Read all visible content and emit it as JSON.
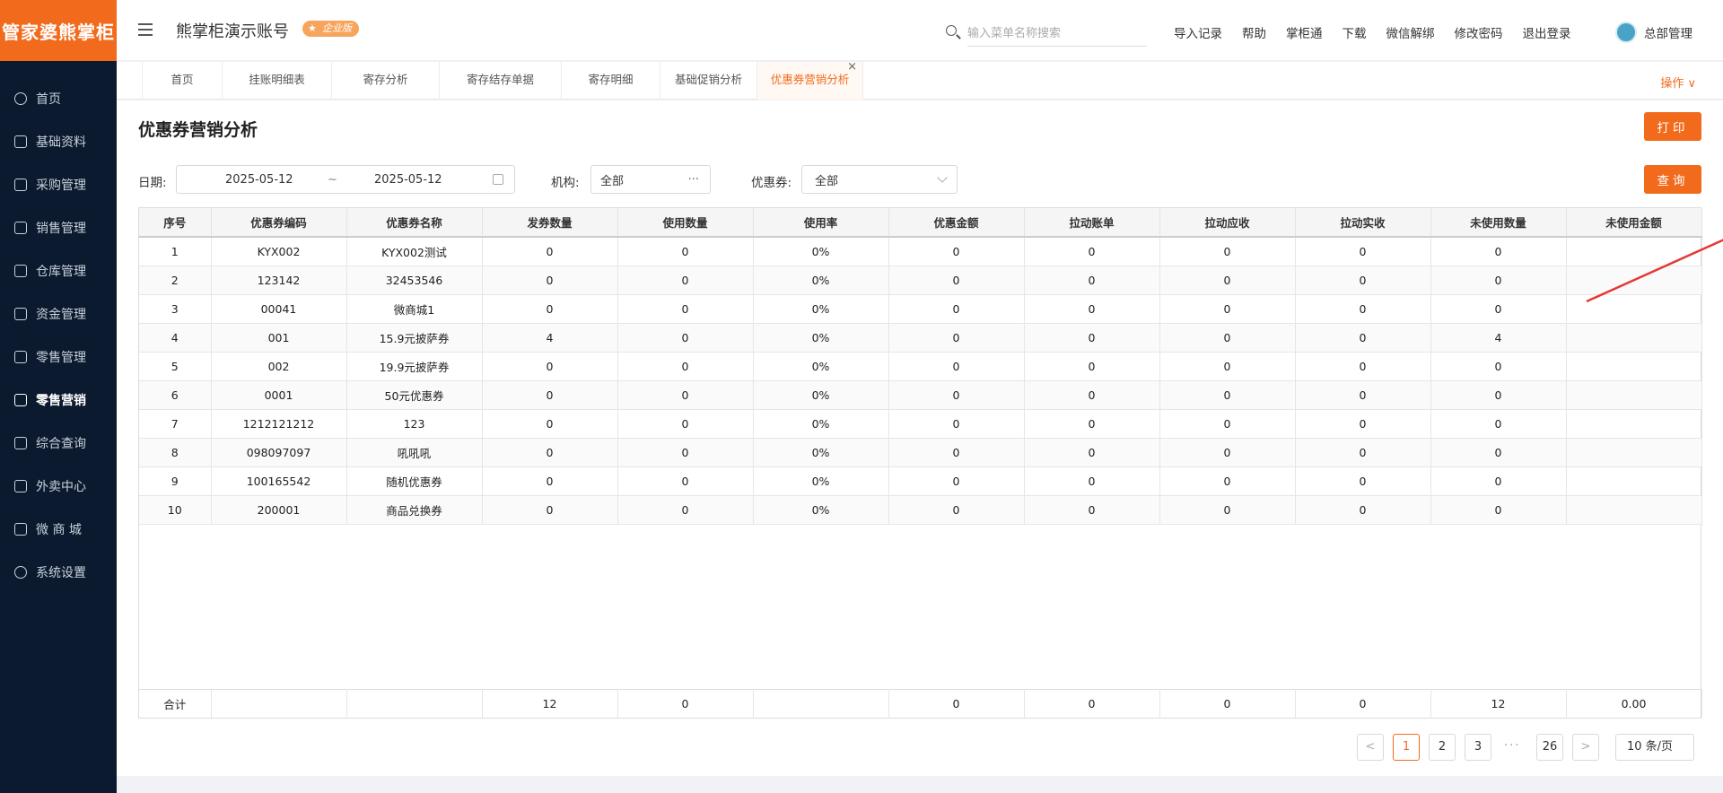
{
  "sidebar": {
    "logo": "管家婆熊掌柜",
    "items": [
      {
        "label": "首页",
        "icon": "globe-icon"
      },
      {
        "label": "基础资料",
        "icon": "home-icon"
      },
      {
        "label": "采购管理",
        "icon": "cart-icon"
      },
      {
        "label": "销售管理",
        "icon": "calendar-icon"
      },
      {
        "label": "仓库管理",
        "icon": "warehouse-icon"
      },
      {
        "label": "资金管理",
        "icon": "money-icon"
      },
      {
        "label": "零售管理",
        "icon": "chart-icon"
      },
      {
        "label": "零售营销",
        "icon": "gift-icon",
        "active": true
      },
      {
        "label": "综合查询",
        "icon": "bar-chart-icon"
      },
      {
        "label": "外卖中心",
        "icon": "bell-icon"
      },
      {
        "label": "微 商 城",
        "icon": "bag-icon"
      },
      {
        "label": "系统设置",
        "icon": "gear-icon"
      }
    ]
  },
  "header": {
    "account": "熊掌柜演示账号",
    "edition": "企业版",
    "search_placeholder": "输入菜单名称搜索",
    "links": [
      "导入记录",
      "帮助",
      "掌柜通",
      "下载",
      "微信解绑",
      "修改密码",
      "退出登录"
    ],
    "user": "总部管理"
  },
  "tabs": {
    "items": [
      "首页",
      "挂账明细表",
      "寄存分析",
      "寄存结存单据",
      "寄存明细",
      "基础促销分析",
      "优惠券营销分析"
    ],
    "close": "×",
    "ops": "操作 ∨"
  },
  "page": {
    "title": "优惠券营销分析",
    "print": "打印",
    "query": "查询"
  },
  "filters": {
    "date_label": "日期:",
    "date_start": "2025-05-12",
    "date_sep": "~",
    "date_end": "2025-05-12",
    "org_label": "机构:",
    "org_value": "全部",
    "org_more": "···",
    "coupon_label": "优惠券:",
    "coupon_value": "全部"
  },
  "table": {
    "columns": [
      "序号",
      "优惠券编码",
      "优惠券名称",
      "发券数量",
      "使用数量",
      "使用率",
      "优惠金额",
      "拉动账单",
      "拉动应收",
      "拉动实收",
      "未使用数量",
      "未使用金额"
    ],
    "rows": [
      [
        "1",
        "KYX002",
        "KYX002测试",
        "0",
        "0",
        "0%",
        "0",
        "0",
        "0",
        "0",
        "0",
        ""
      ],
      [
        "2",
        "123142",
        "32453546",
        "0",
        "0",
        "0%",
        "0",
        "0",
        "0",
        "0",
        "0",
        ""
      ],
      [
        "3",
        "00041",
        "微商城1",
        "0",
        "0",
        "0%",
        "0",
        "0",
        "0",
        "0",
        "0",
        ""
      ],
      [
        "4",
        "001",
        "15.9元披萨券",
        "4",
        "0",
        "0%",
        "0",
        "0",
        "0",
        "0",
        "4",
        ""
      ],
      [
        "5",
        "002",
        "19.9元披萨券",
        "0",
        "0",
        "0%",
        "0",
        "0",
        "0",
        "0",
        "0",
        ""
      ],
      [
        "6",
        "0001",
        "50元优惠券",
        "0",
        "0",
        "0%",
        "0",
        "0",
        "0",
        "0",
        "0",
        ""
      ],
      [
        "7",
        "1212121212",
        "123",
        "0",
        "0",
        "0%",
        "0",
        "0",
        "0",
        "0",
        "0",
        ""
      ],
      [
        "8",
        "098097097",
        "吼吼吼",
        "0",
        "0",
        "0%",
        "0",
        "0",
        "0",
        "0",
        "0",
        ""
      ],
      [
        "9",
        "100165542",
        "随机优惠券",
        "0",
        "0",
        "0%",
        "0",
        "0",
        "0",
        "0",
        "0",
        ""
      ],
      [
        "10",
        "200001",
        "商品兑换券",
        "0",
        "0",
        "0%",
        "0",
        "0",
        "0",
        "0",
        "0",
        ""
      ]
    ],
    "totals": [
      "合计",
      "",
      "",
      "12",
      "0",
      "",
      "0",
      "0",
      "0",
      "0",
      "12",
      "0.00"
    ]
  },
  "pagination": {
    "prev": "<",
    "pages": [
      "1",
      "2",
      "3"
    ],
    "dots": "···",
    "last": "26",
    "next": ">",
    "size": "10 条/页",
    "current": "1"
  },
  "colors": {
    "accent": "#f26b1d",
    "sidebar": "#0b1a2e",
    "arrow": "#e53935"
  }
}
